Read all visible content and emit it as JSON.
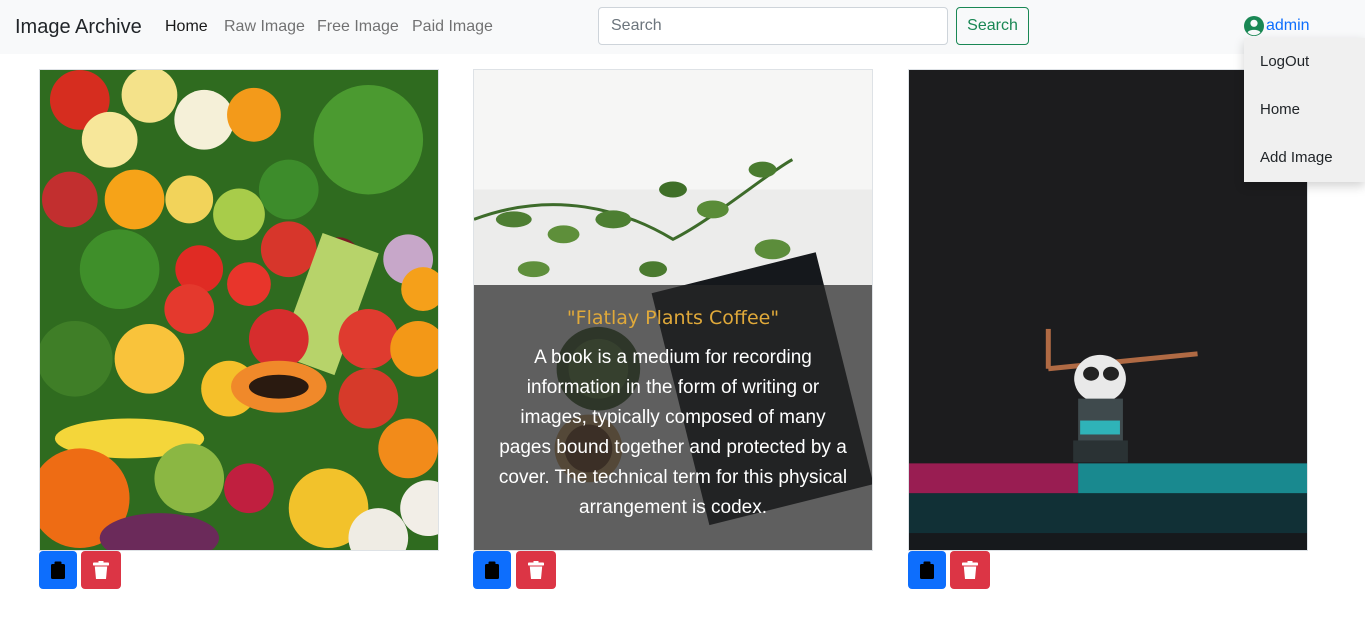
{
  "navbar": {
    "brand": "Image Archive",
    "links": [
      {
        "label": "Home",
        "active": true
      },
      {
        "label": "Raw Image",
        "active": false
      },
      {
        "label": "Free Image",
        "active": false
      },
      {
        "label": "Paid Image",
        "active": false
      }
    ],
    "search": {
      "placeholder": "Search",
      "value": "",
      "button_label": "Search"
    },
    "user": {
      "name": "admin",
      "icon": "user-circle-icon"
    }
  },
  "dropdown": {
    "items": [
      "LogOut",
      "Home",
      "Add Image"
    ]
  },
  "cards": [
    {
      "image": "vegetables-and-fruits-photo",
      "actions": [
        "clipboard-icon",
        "trash-icon"
      ]
    },
    {
      "image": "flatlay-plants-book-photo",
      "overlay_title": "\"Flatlay Plants Coffee\"",
      "overlay_description": "A book is a medium for recording information in the form of writing or images, typically composed of many pages bound together and protected by a cover. The technical term for this physical arrangement is codex.",
      "actions": [
        "clipboard-icon",
        "trash-icon"
      ]
    },
    {
      "image": "panda-toy-neon-photo",
      "actions": [
        "clipboard-icon",
        "trash-icon"
      ]
    }
  ],
  "colors": {
    "primary": "#0d6efd",
    "danger": "#dc3545",
    "success": "#198754",
    "overlay_title": "#e0a93a"
  }
}
